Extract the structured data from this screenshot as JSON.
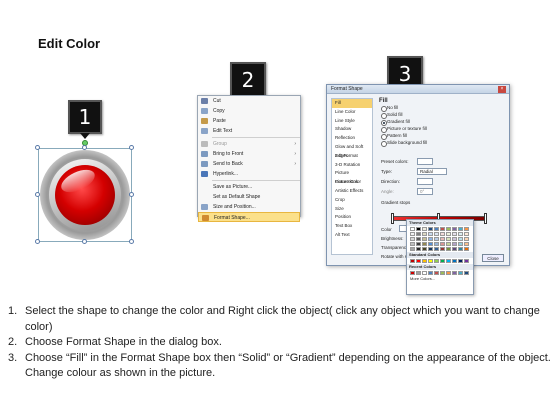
{
  "title": "Edit Color",
  "steps": [
    "1",
    "2",
    "3"
  ],
  "context_menu": {
    "items": [
      {
        "label": "Cut",
        "icon": "scissors-icon",
        "color": "#6b7fa8"
      },
      {
        "label": "Copy",
        "icon": "copy-icon",
        "color": "#8aa4c8"
      },
      {
        "label": "Paste",
        "icon": "clipboard-icon",
        "color": "#c49a4a"
      },
      {
        "label": "Edit Text",
        "icon": "text-edit-icon",
        "color": "#8aa4c8"
      },
      {
        "label": "Group",
        "icon": "group-icon",
        "color": "#bbbbbb",
        "disabled": true,
        "submenu": true
      },
      {
        "label": "Bring to Front",
        "icon": "bring-front-icon",
        "color": "#7c9ac0",
        "submenu": true
      },
      {
        "label": "Send to Back",
        "icon": "send-back-icon",
        "color": "#7c9ac0",
        "submenu": true
      },
      {
        "label": "Hyperlink...",
        "icon": "hyperlink-icon",
        "color": "#4a76b8"
      },
      {
        "label": "Save as Picture...",
        "icon": "",
        "color": ""
      },
      {
        "label": "Set as Default Shape",
        "icon": "",
        "color": ""
      },
      {
        "label": "Size and Position...",
        "icon": "size-icon",
        "color": "#8aa4c8"
      },
      {
        "label": "Format Shape...",
        "icon": "format-icon",
        "color": "#d08a30",
        "highlight": true
      }
    ]
  },
  "dialog": {
    "title": "Format Shape",
    "nav": [
      "Fill",
      "Line Color",
      "Line Style",
      "Shadow",
      "Reflection",
      "Glow and Soft Edges",
      "3-D Format",
      "3-D Rotation",
      "Picture Corrections",
      "Picture Color",
      "Artistic Effects",
      "Crop",
      "Size",
      "Position",
      "Text Box",
      "Alt Text"
    ],
    "active_nav": "Fill",
    "fill_heading": "Fill",
    "fill_options": [
      "No fill",
      "Solid fill",
      "Gradient fill",
      "Picture or texture fill",
      "Pattern fill",
      "Slide background fill"
    ],
    "checked_option": "Gradient fill",
    "preset_colors_label": "Preset colors:",
    "type_label": "Type:",
    "type_value": "Radial",
    "direction_label": "Direction:",
    "angle_label": "Angle:",
    "angle_value": "0°",
    "gradient_stops_label": "Gradient stops",
    "color_label": "Color",
    "position_label": "Position:",
    "position_value": "100%",
    "brightness_label": "Brightness:",
    "transparency_label": "Transparency:",
    "rotate_label": "Rotate with shape",
    "close_label": "Close"
  },
  "palette": {
    "theme_label": "Theme Colors",
    "theme_colors": [
      [
        "#ffffff",
        "#000000",
        "#eeece1",
        "#1f497d",
        "#4f81bd",
        "#c0504d",
        "#9bbb59",
        "#8064a2",
        "#4bacc6",
        "#f79646"
      ],
      [
        "#f2f2f2",
        "#7f7f7f",
        "#ddd9c3",
        "#c6d9f0",
        "#dbe5f1",
        "#f2dcdb",
        "#ebf1dd",
        "#e5e0ec",
        "#dbeef3",
        "#fdeada"
      ],
      [
        "#d8d8d8",
        "#595959",
        "#c4bd97",
        "#8db3e2",
        "#b8cce4",
        "#e5b9b7",
        "#d7e3bc",
        "#ccc1d9",
        "#b7dde8",
        "#fbd5b5"
      ],
      [
        "#bfbfbf",
        "#3f3f3f",
        "#938953",
        "#548dd4",
        "#95b3d7",
        "#d99694",
        "#c3d69b",
        "#b2a2c7",
        "#92cddc",
        "#fac08f"
      ],
      [
        "#a5a5a5",
        "#262626",
        "#494429",
        "#17365d",
        "#366092",
        "#953734",
        "#76923c",
        "#5f497a",
        "#31859b",
        "#e36c09"
      ]
    ],
    "standard_label": "Standard Colors",
    "standard_colors": [
      "#c00000",
      "#ff0000",
      "#ffc000",
      "#ffff00",
      "#92d050",
      "#00b050",
      "#00b0f0",
      "#0070c0",
      "#002060",
      "#7030a0"
    ],
    "recent_label": "Recent Colors",
    "recent_colors": [
      "#d00000",
      "#a0a0a0",
      "#ffffff",
      "#4f81bd",
      "#c0504d",
      "#9bbb59",
      "#f79646",
      "#8064a2",
      "#4bacc6",
      "#1f497d"
    ],
    "more_label": "More Colors..."
  },
  "instructions": [
    {
      "num": "1.",
      "text": "Select the shape to change the color and Right click the object( click any object which you want to change color)"
    },
    {
      "num": "2.",
      "text": "Choose Format Shape in the dialog box."
    },
    {
      "num": "3.",
      "text": "Choose “Fill” in the Format Shape box then “Solid” or “Gradient” depending on the appearance of the object. Change colour as shown in the picture."
    }
  ],
  "colors": {
    "shape_red": "#d40000",
    "highlight": "#fbe08a",
    "step_box": "#111111"
  }
}
